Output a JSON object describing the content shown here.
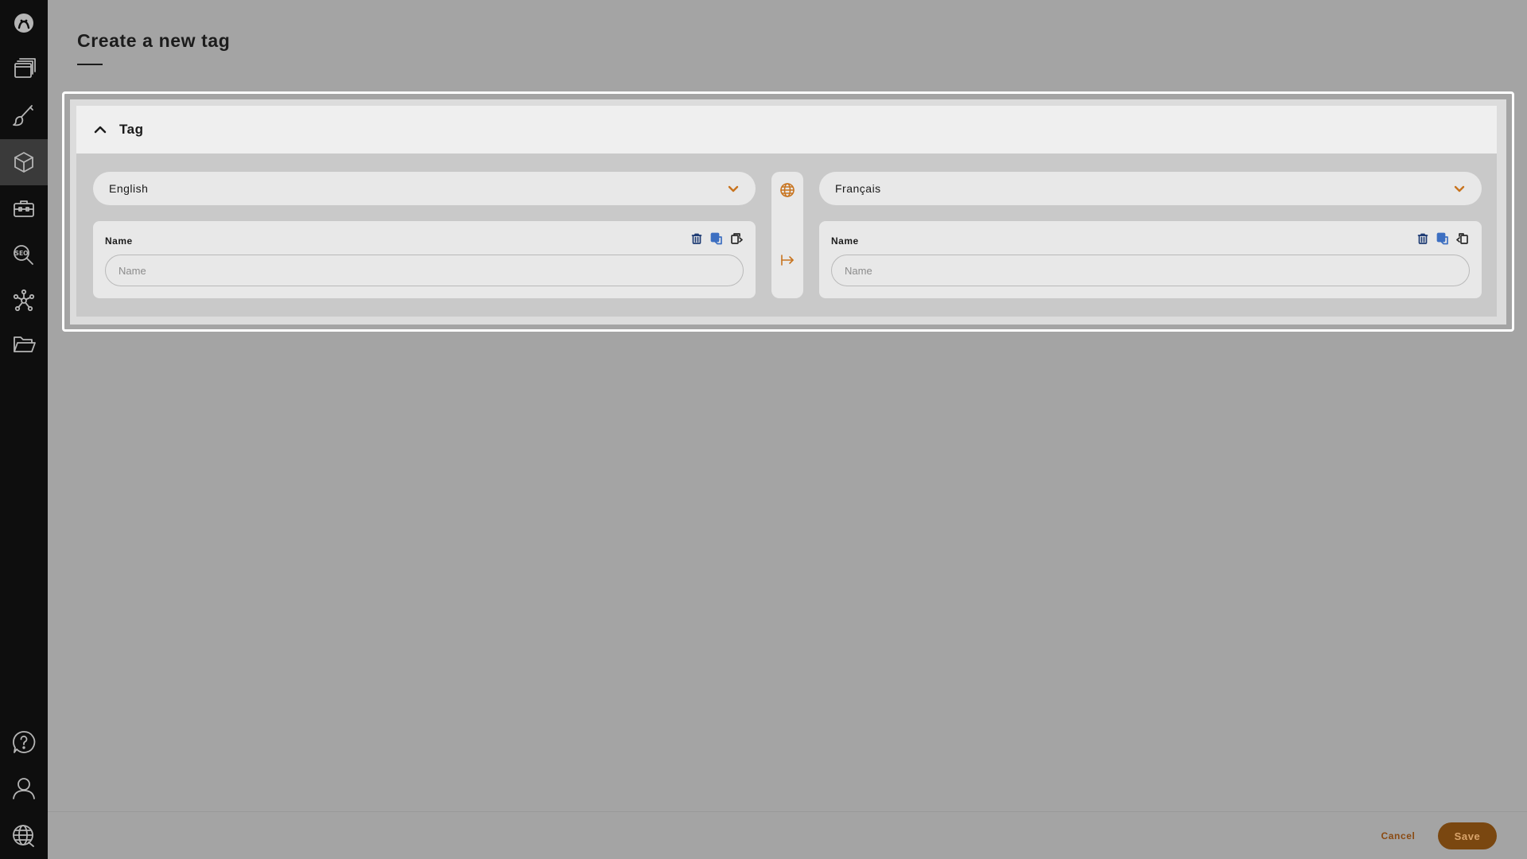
{
  "sidebar": {
    "items": [
      {
        "icon": "logo-icon"
      },
      {
        "icon": "windows-icon"
      },
      {
        "icon": "brush-icon"
      },
      {
        "icon": "box-icon",
        "active": true
      },
      {
        "icon": "toolbox-icon"
      },
      {
        "icon": "seo-icon",
        "label": "SEO"
      },
      {
        "icon": "network-icon"
      },
      {
        "icon": "folder-open-icon"
      }
    ],
    "bottom_items": [
      {
        "icon": "help-icon"
      },
      {
        "icon": "user-icon"
      },
      {
        "icon": "globe-icon"
      }
    ]
  },
  "page": {
    "title": "Create a new tag"
  },
  "card": {
    "title": "Tag",
    "left": {
      "language": "English",
      "field_label": "Name",
      "field_placeholder": "Name",
      "field_value": ""
    },
    "right": {
      "language": "Français",
      "field_label": "Name",
      "field_placeholder": "Name",
      "field_value": ""
    }
  },
  "footer": {
    "cancel_label": "Cancel",
    "save_label": "Save"
  },
  "colors": {
    "accent": "#c8741f",
    "save_button_bg": "#7a4710",
    "sidebar_bg": "#0e0e0e",
    "overlay_bg": "#a4a4a4"
  }
}
